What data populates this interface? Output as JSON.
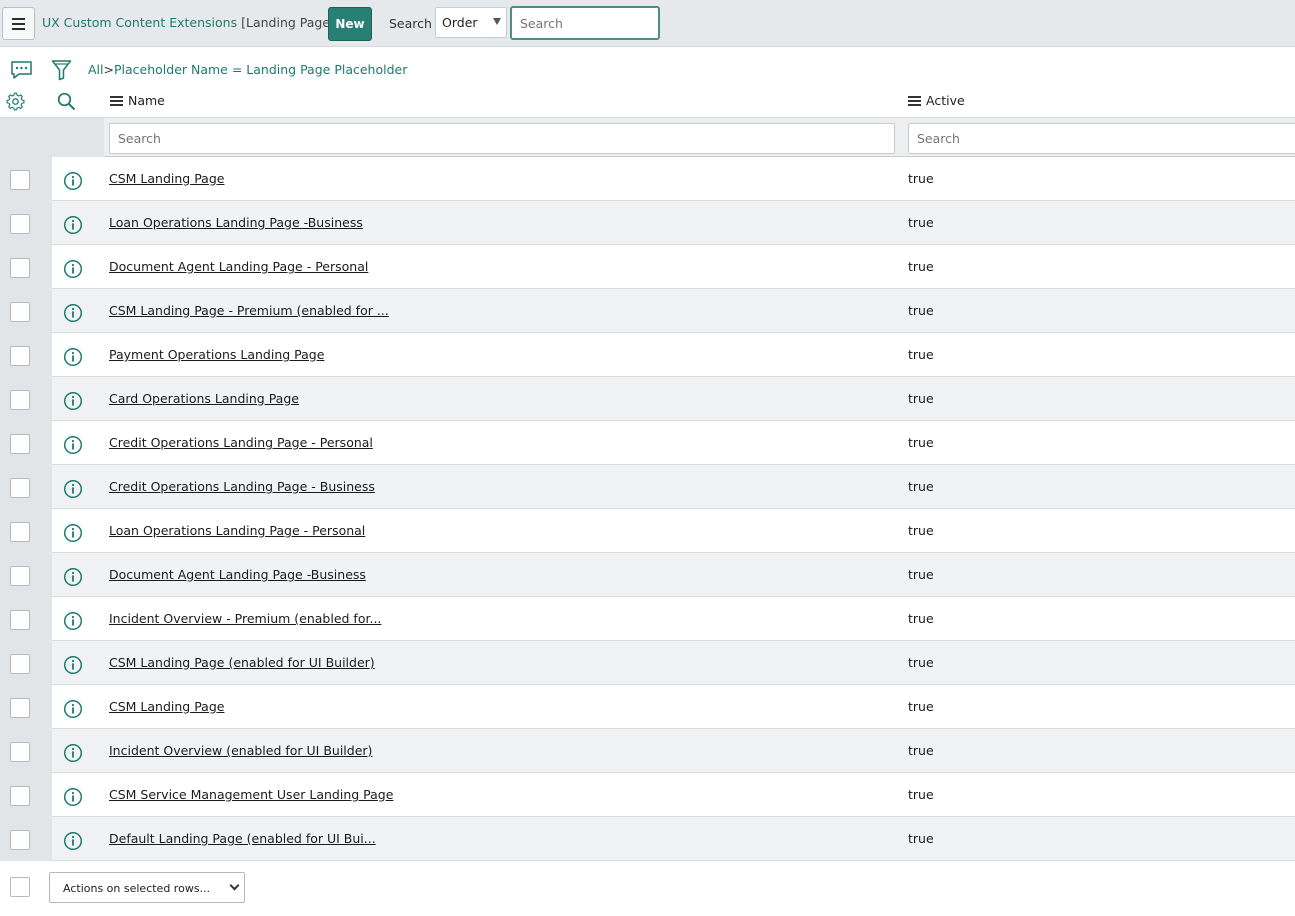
{
  "header": {
    "menu_icon": "hamburger-icon",
    "title": "UX Custom Content Extensions",
    "title_view": "[Landing Page view]",
    "new_label": "New",
    "search_label": "Search",
    "search_field_selected": "Order",
    "search_placeholder": "Search"
  },
  "breadcrumb": {
    "all_label": "All",
    "separator": ">",
    "filter_label": "Placeholder Name = Landing Page Placeholder"
  },
  "columns": {
    "name_header": "Name",
    "active_header": "Active",
    "name_search_placeholder": "Search",
    "active_search_placeholder": "Search"
  },
  "rows": [
    {
      "name": "CSM Landing Page",
      "active": "true"
    },
    {
      "name": "Loan Operations Landing Page -Business",
      "active": "true"
    },
    {
      "name": "Document Agent Landing Page - Personal",
      "active": "true"
    },
    {
      "name": "CSM Landing Page - Premium (enabled for ...",
      "active": "true"
    },
    {
      "name": "Payment Operations Landing Page",
      "active": "true"
    },
    {
      "name": "Card Operations Landing Page",
      "active": "true"
    },
    {
      "name": "Credit Operations Landing Page - Personal",
      "active": "true"
    },
    {
      "name": "Credit Operations Landing Page - Business",
      "active": "true"
    },
    {
      "name": "Loan Operations Landing Page - Personal",
      "active": "true"
    },
    {
      "name": "Document Agent Landing Page -Business",
      "active": "true"
    },
    {
      "name": "Incident Overview - Premium (enabled for...",
      "active": "true"
    },
    {
      "name": "CSM Landing Page (enabled for UI Builder)",
      "active": "true"
    },
    {
      "name": "CSM Landing Page",
      "active": "true"
    },
    {
      "name": "Incident Overview (enabled for UI Builder)",
      "active": "true"
    },
    {
      "name": "CSM Service Management User Landing Page",
      "active": "true"
    },
    {
      "name": "Default Landing Page (enabled for UI Bui...",
      "active": "true"
    }
  ],
  "footer": {
    "actions_label": "Actions on selected rows..."
  },
  "colors": {
    "accent": "#278073",
    "link_teal": "#1f7a6c",
    "header_bg": "#e6e9eb"
  }
}
